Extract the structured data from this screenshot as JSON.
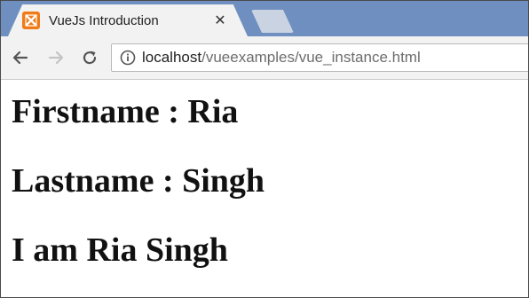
{
  "browser": {
    "tab": {
      "title": "VueJs Introduction",
      "favicon": "xampp-icon",
      "close_glyph": "✕"
    },
    "address": {
      "host": "localhost",
      "path": "/vueexamples/vue_instance.html"
    },
    "icons": {
      "back": "back-arrow-icon",
      "forward": "forward-arrow-icon",
      "reload": "reload-icon",
      "info": "info-icon"
    }
  },
  "page": {
    "lines": [
      "Firstname : Ria",
      "Lastname : Singh",
      "I am Ria Singh"
    ]
  },
  "colors": {
    "tabstrip": "#6e8fbf",
    "favicon": "#f07a16"
  }
}
